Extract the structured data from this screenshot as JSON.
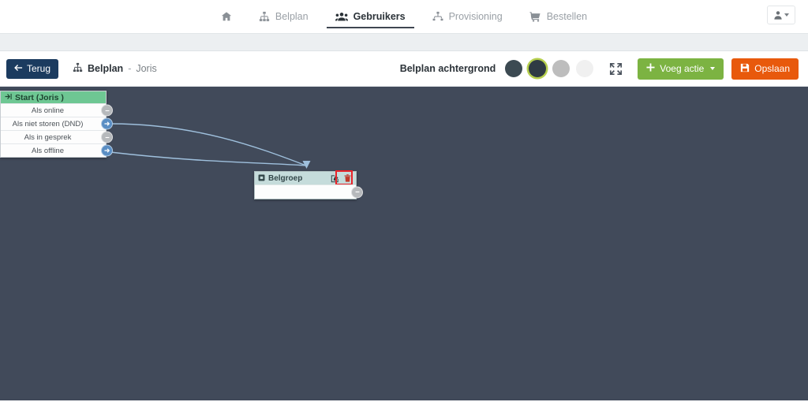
{
  "header": {
    "nav": [
      {
        "label": "",
        "icon": "home-icon",
        "active": false,
        "name": "nav-home"
      },
      {
        "label": "Belplan",
        "icon": "sitemap-icon",
        "active": false,
        "name": "nav-belplan"
      },
      {
        "label": "Gebruikers",
        "icon": "users-icon",
        "active": true,
        "name": "nav-gebruikers"
      },
      {
        "label": "Provisioning",
        "icon": "network-icon",
        "active": false,
        "name": "nav-provisioning"
      },
      {
        "label": "Bestellen",
        "icon": "cart-icon",
        "active": false,
        "name": "nav-bestellen"
      }
    ],
    "user_menu": {
      "icon": "user-icon",
      "caret": "chevron-down-icon"
    }
  },
  "toolbar": {
    "back_label": "Terug",
    "back_icon": "arrow-left-icon",
    "breadcrumb": {
      "icon": "sitemap-icon",
      "title": "Belplan",
      "separator": "-",
      "subject": "Joris"
    },
    "background_label": "Belplan achtergrond",
    "swatches": [
      {
        "name": "swatch-dark-slate",
        "color": "#3c4a52",
        "selected": false
      },
      {
        "name": "swatch-dark-navy",
        "color": "#2f3b44",
        "selected": true
      },
      {
        "name": "swatch-grey",
        "color": "#bdbdbd",
        "selected": false
      },
      {
        "name": "swatch-light",
        "color": "#f0f0f0",
        "selected": false
      }
    ],
    "selected_ring_color": "#b6cf4e",
    "expand_icon": "expand-arrows-icon",
    "add_action_label": "Voeg actie",
    "add_action_icon": "plus-icon",
    "add_action_caret": "chevron-down-icon",
    "save_label": "Opslaan",
    "save_icon": "floppy-save-icon",
    "colors": {
      "back": "#1b3b5f",
      "add": "#7cb342",
      "save": "#e8590c"
    }
  },
  "canvas": {
    "background_color": "#414a5a",
    "edge_color": "#9fc0dd",
    "nodes": [
      {
        "name": "node-start",
        "icon": "sign-in-icon",
        "title": "Start (Joris )",
        "header_color": "#6ec793",
        "rows": [
          {
            "label": "Als online",
            "port": "inactive",
            "port_icon": "minus-circle-icon"
          },
          {
            "label": "Als niet storen (DND)",
            "port": "active",
            "port_icon": "arrow-right-circle-icon"
          },
          {
            "label": "Als in gesprek",
            "port": "inactive",
            "port_icon": "minus-circle-icon"
          },
          {
            "label": "Als offline",
            "port": "active",
            "port_icon": "arrow-right-circle-icon"
          }
        ]
      },
      {
        "name": "node-belgroep",
        "icon": "phone-group-icon",
        "title": "Belgroep",
        "header_color": "#c5dcdb",
        "edit_icon": "edit-pencil-square-icon",
        "delete_icon": "trash-icon",
        "body_port": "inactive",
        "body_port_icon": "minus-circle-icon",
        "highlight": {
          "color": "#e8232a",
          "target": "edit-pencil-square-icon"
        }
      }
    ],
    "edges": [
      {
        "from": "node-start.row-2-port",
        "to": "node-belgroep.top"
      },
      {
        "from": "node-start.row-4-port",
        "to": "node-belgroep.top"
      }
    ]
  }
}
